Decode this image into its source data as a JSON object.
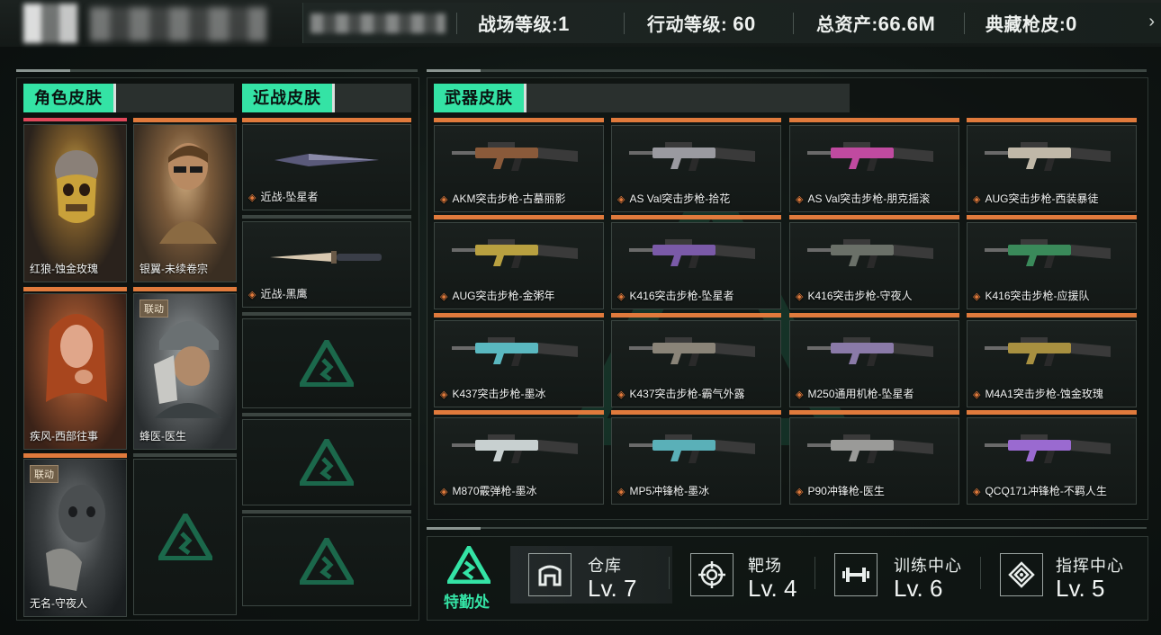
{
  "header": {
    "stats": [
      {
        "label": "战场等级:",
        "value": "1"
      },
      {
        "label": "行动等级: ",
        "value": "60"
      },
      {
        "label": "总资产:",
        "value": "66.6M"
      },
      {
        "label": "典藏枪皮:",
        "value": "0"
      }
    ],
    "next_icon": "chevron-right-icon"
  },
  "sections": {
    "character": "角色皮肤",
    "melee": "近战皮肤",
    "weapon": "武器皮肤"
  },
  "characters": [
    {
      "name": "红狼-蚀金玫瑰",
      "tag": "",
      "colors": [
        "#3a2a1e",
        "#b89a4a",
        "#2a2320"
      ]
    },
    {
      "name": "银翼-未续卷宗",
      "tag": "",
      "colors": [
        "#6b5238",
        "#c9a67a",
        "#3a2e22"
      ]
    },
    {
      "name": "疾风-西部往事",
      "tag": "",
      "colors": [
        "#8a4a2a",
        "#c97a4a",
        "#4a2a1a"
      ]
    },
    {
      "name": "蜂医-医生",
      "tag": "联动",
      "colors": [
        "#5a5e60",
        "#9aa0a2",
        "#2e3234"
      ]
    },
    {
      "name": "无名-守夜人",
      "tag": "联动",
      "colors": [
        "#3a3e40",
        "#6a6e70",
        "#1e2224"
      ]
    }
  ],
  "melee": [
    {
      "name": "近战-坠星者"
    },
    {
      "name": "近战-黑鹰"
    }
  ],
  "weapons": [
    {
      "name": "AKM突击步枪-古墓丽影",
      "color": "#8a5a3a"
    },
    {
      "name": "AS Val突击步枪-拾花",
      "color": "#9a9aa0"
    },
    {
      "name": "AS Val突击步枪-朋克摇滚",
      "color": "#c04aa0"
    },
    {
      "name": "AUG突击步枪-西装暴徒",
      "color": "#c0b8a8"
    },
    {
      "name": "AUG突击步枪-金粥年",
      "color": "#b8a040"
    },
    {
      "name": "K416突击步枪-坠星者",
      "color": "#7a5aa8"
    },
    {
      "name": "K416突击步枪-守夜人",
      "color": "#6a7068"
    },
    {
      "name": "K416突击步枪-应援队",
      "color": "#3a8a5a"
    },
    {
      "name": "K437突击步枪-墨冰",
      "color": "#5ab8c0"
    },
    {
      "name": "K437突击步枪-霸气外露",
      "color": "#8a8478"
    },
    {
      "name": "M250通用机枪-坠星者",
      "color": "#8a7aa8"
    },
    {
      "name": "M4A1突击步枪-蚀金玫瑰",
      "color": "#a89040"
    },
    {
      "name": "M870霰弹枪-墨冰",
      "color": "#c8d0d0"
    },
    {
      "name": "MP5冲锋枪-墨冰",
      "color": "#5ab0b8"
    },
    {
      "name": "P90冲锋枪-医生",
      "color": "#9a9a98"
    },
    {
      "name": "QCQ171冲锋枪-不羁人生",
      "color": "#9a6ad0"
    }
  ],
  "facilities": {
    "badge_label": "特勤处",
    "items": [
      {
        "name": "仓库",
        "level": "Lv. 7",
        "icon": "warehouse-icon"
      },
      {
        "name": "靶场",
        "level": "Lv. 4",
        "icon": "target-icon"
      },
      {
        "name": "训练中心",
        "level": "Lv. 6",
        "icon": "dumbbell-icon"
      },
      {
        "name": "指挥中心",
        "level": "Lv. 5",
        "icon": "command-icon"
      }
    ]
  },
  "colors": {
    "accent_green": "#34e3a5",
    "accent_orange": "#e07a3c",
    "accent_red": "#e0475a"
  }
}
